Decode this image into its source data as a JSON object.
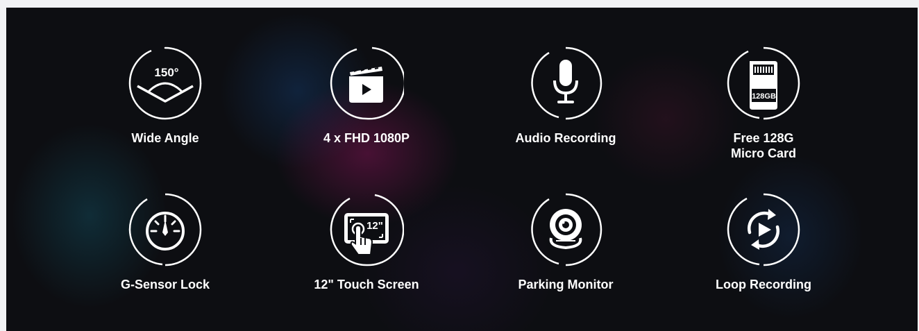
{
  "features": [
    {
      "label": "Wide Angle",
      "icon": "wide-angle-icon",
      "icon_text": "150°"
    },
    {
      "label": "4 x FHD 1080P",
      "icon": "clapperboard-icon"
    },
    {
      "label": "Audio Recording",
      "icon": "microphone-icon"
    },
    {
      "label_line1": "Free 128G",
      "label_line2": "Micro Card",
      "icon": "sd-card-icon",
      "icon_text": "128GB"
    },
    {
      "label": "G-Sensor Lock",
      "icon": "gauge-icon"
    },
    {
      "label": "12\" Touch Screen",
      "icon": "touch-screen-icon",
      "icon_text": "12\""
    },
    {
      "label": "Parking Monitor",
      "icon": "webcam-icon"
    },
    {
      "label": "Loop Recording",
      "icon": "loop-icon"
    }
  ],
  "colors": {
    "background": "#0d0e12",
    "foreground": "#ffffff",
    "page": "#f1f2f4"
  }
}
